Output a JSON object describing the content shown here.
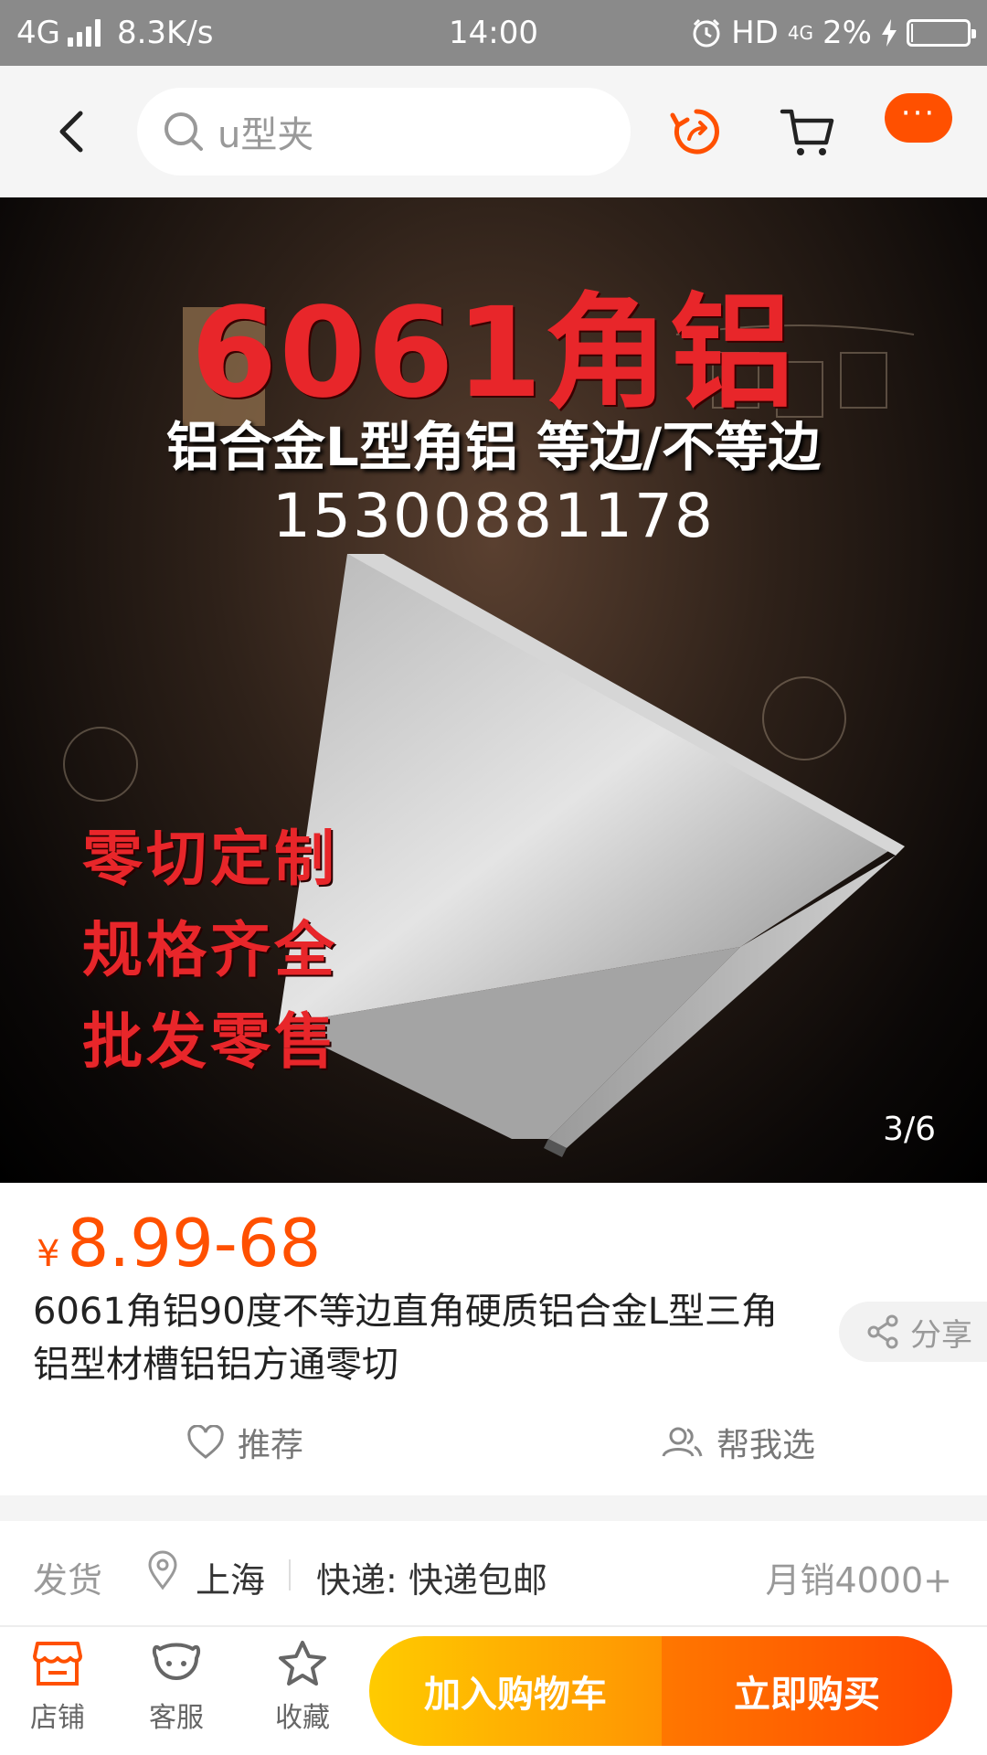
{
  "status_bar": {
    "network": "4G",
    "speed": "8.3K/s",
    "time": "14:00",
    "hd": "HD",
    "hd_network": "4G",
    "battery_percent": "2%",
    "battery_level": 0.02
  },
  "nav": {
    "search_placeholder": "u型夹",
    "more_label": "···"
  },
  "hero": {
    "headline": "6061角铝",
    "subtitle": "铝合金L型角铝  等边/不等边",
    "phone": "15300881178",
    "slogans": [
      "零切定制",
      "规格齐全",
      "批发零售"
    ],
    "counter": "3/6"
  },
  "product": {
    "currency": "¥",
    "price": "8.99-68",
    "title": "6061角铝90度不等边直角硬质铝合金L型三角铝型材槽铝铝方通零切",
    "share_label": "分享",
    "recommend_label": "推荐",
    "help_choose_label": "帮我选"
  },
  "shipping": {
    "label": "发货",
    "city": "上海",
    "express": "快递: 快递包邮",
    "monthly_sales": "月销4000+"
  },
  "bottom_bar": {
    "shop_label": "店铺",
    "service_label": "客服",
    "favorite_label": "收藏",
    "add_to_cart_label": "加入购物车",
    "buy_now_label": "立即购买"
  },
  "colors": {
    "accent": "#ff5000",
    "hero_red": "#e8262a"
  }
}
